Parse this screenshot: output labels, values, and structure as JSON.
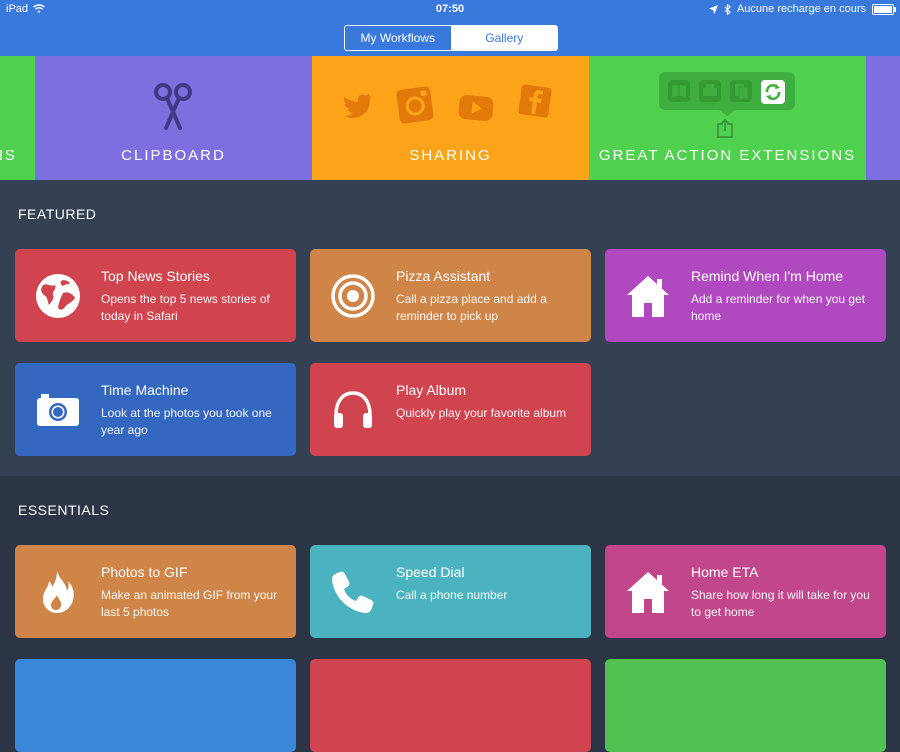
{
  "status_bar": {
    "device": "iPad",
    "time": "07:50",
    "charge": "Aucune recharge en cours"
  },
  "segmented": {
    "tab1": "My Workflows",
    "tab2": "Gallery",
    "selected": "Gallery"
  },
  "banners": [
    {
      "label": "NS",
      "color": "#4fd04f"
    },
    {
      "label": "CLIPBOARD",
      "color": "#7d6fdf",
      "icon": "scissors-icon"
    },
    {
      "label": "SHARING",
      "color": "#fca31a",
      "icons": [
        "twitter-icon",
        "instagram-icon",
        "youtube-icon",
        "facebook-icon"
      ]
    },
    {
      "label": "GREAT ACTION EXTENSIONS",
      "color": "#4fd04f",
      "icons": [
        "book-icon",
        "print-icon",
        "copy-icon",
        "sync-icon",
        "share-icon"
      ]
    }
  ],
  "featured": {
    "title": "FEATURED",
    "cards": [
      {
        "title": "Top News Stories",
        "desc": "Opens the top 5 news stories of today in Safari",
        "color": "#d0444f",
        "icon": "globe-icon"
      },
      {
        "title": "Pizza Assistant",
        "desc": "Call a pizza place and add a reminder to pick up",
        "color": "#cf8448",
        "icon": "target-icon"
      },
      {
        "title": "Remind When I'm Home",
        "desc": "Add a reminder for when you get home",
        "color": "#b048bf",
        "icon": "home-icon"
      },
      {
        "title": "Time Machine",
        "desc": "Look at the photos you took one year ago",
        "color": "#3468c0",
        "icon": "camera-icon"
      },
      {
        "title": "Play Album",
        "desc": "Quickly play your favorite album",
        "color": "#d0444f",
        "icon": "headphones-icon"
      }
    ]
  },
  "essentials": {
    "title": "ESSENTIALS",
    "cards": [
      {
        "title": "Photos to GIF",
        "desc": "Make an animated GIF from your last 5 photos",
        "color": "#cf8448",
        "icon": "flame-icon"
      },
      {
        "title": "Speed Dial",
        "desc": "Call a phone number",
        "color": "#4ab3bf",
        "icon": "phone-icon"
      },
      {
        "title": "Home ETA",
        "desc": "Share how long it will take for you to get home",
        "color": "#c1468a",
        "icon": "home-icon"
      }
    ],
    "partial_colors": [
      "#3a86d8",
      "#d0444f",
      "#4fc24f"
    ]
  }
}
